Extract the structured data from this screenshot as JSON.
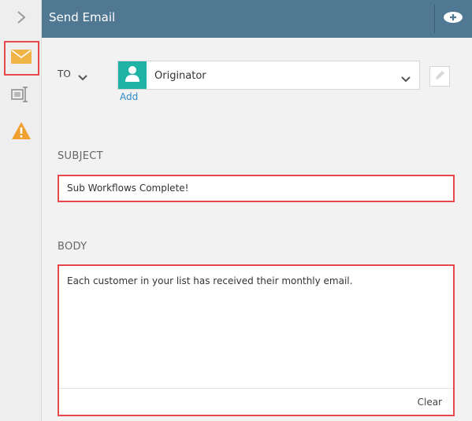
{
  "header": {
    "title": "Send Email",
    "add_icon": "plus-cloud-icon"
  },
  "rail": {
    "items": [
      "chevron-right-icon",
      "envelope-icon",
      "form-field-icon",
      "warning-icon"
    ]
  },
  "to": {
    "label": "TO",
    "recipient": "Originator",
    "add_link": "Add"
  },
  "subject": {
    "label": "SUBJECT",
    "value": "Sub Workflows Complete!"
  },
  "body": {
    "label": "BODY",
    "value": "Each customer in your list has received their monthly email.",
    "clear_label": "Clear"
  },
  "colors": {
    "header": "#507892",
    "accent": "#1fb3a6",
    "highlight": "#e8474c",
    "mail_icon": "#f0b347",
    "link": "#2f8ccb"
  }
}
